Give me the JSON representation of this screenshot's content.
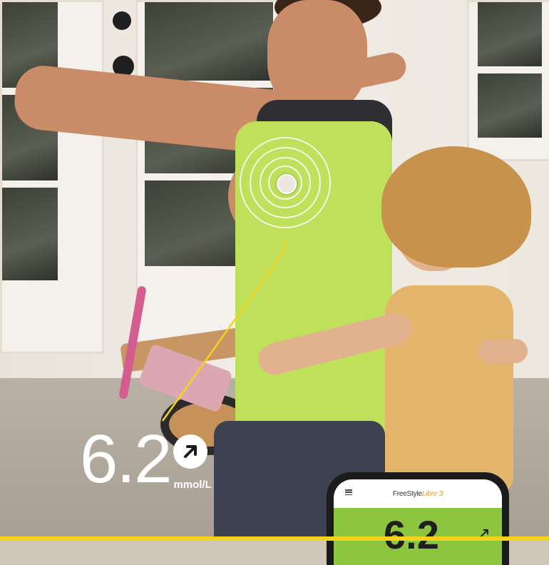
{
  "reading": {
    "value": "6.2",
    "unit": "mmol/L",
    "trend_icon": "trend-arrow-up-right-icon"
  },
  "phone": {
    "app_title_prefix": "FreeStyle",
    "app_title_brand": "Libre",
    "app_title_suffix": " 3",
    "value": "6.2",
    "arrow": "↗"
  },
  "colors": {
    "accent_yellow": "#f5d21c",
    "reading_green": "#8cc63f",
    "tank_green": "#bfe05a"
  }
}
